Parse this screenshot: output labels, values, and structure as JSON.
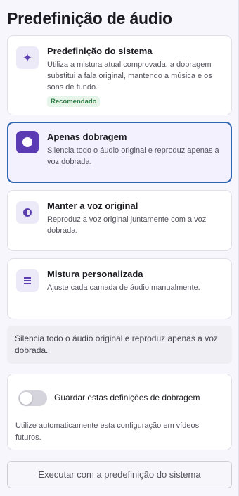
{
  "header": {
    "title": "Predefinição de áudio"
  },
  "presets": [
    {
      "title": "Predefinição do sistema",
      "description": "Utiliza a mistura atual comprovada: a dobragem substitui a fala original, mantendo a música e os sons de fundo.",
      "badge": "Recomendado",
      "icon": "sparkle-icon",
      "selected": false
    },
    {
      "title": "Apenas dobragem",
      "description": "Silencia todo o áudio original e reproduz apenas a voz dobrada.",
      "icon": "filled-circle-icon",
      "selected": true
    },
    {
      "title": "Manter a voz original",
      "description": "Reproduz a voz original juntamente com a voz dobrada.",
      "icon": "half-circle-icon",
      "selected": false
    },
    {
      "title": "Mistura personalizada",
      "description": "Ajuste cada camada de áudio manualmente.",
      "icon": "equalizer-lines-icon",
      "selected": false
    }
  ],
  "info": {
    "text": "Silencia todo o áudio original e reproduz apenas a voz dobrada."
  },
  "save_settings": {
    "label": "Guardar estas definições de dobragem",
    "description": "Utilize automaticamente esta configuração em vídeos futuros.",
    "enabled": false
  },
  "footer": {
    "run_label": "Executar com a predefinição do sistema"
  },
  "colors": {
    "accent": "#5a3bb4",
    "selected_border": "#2f66b3",
    "badge_bg": "#e6f4ea",
    "badge_text": "#2a7a3f"
  }
}
